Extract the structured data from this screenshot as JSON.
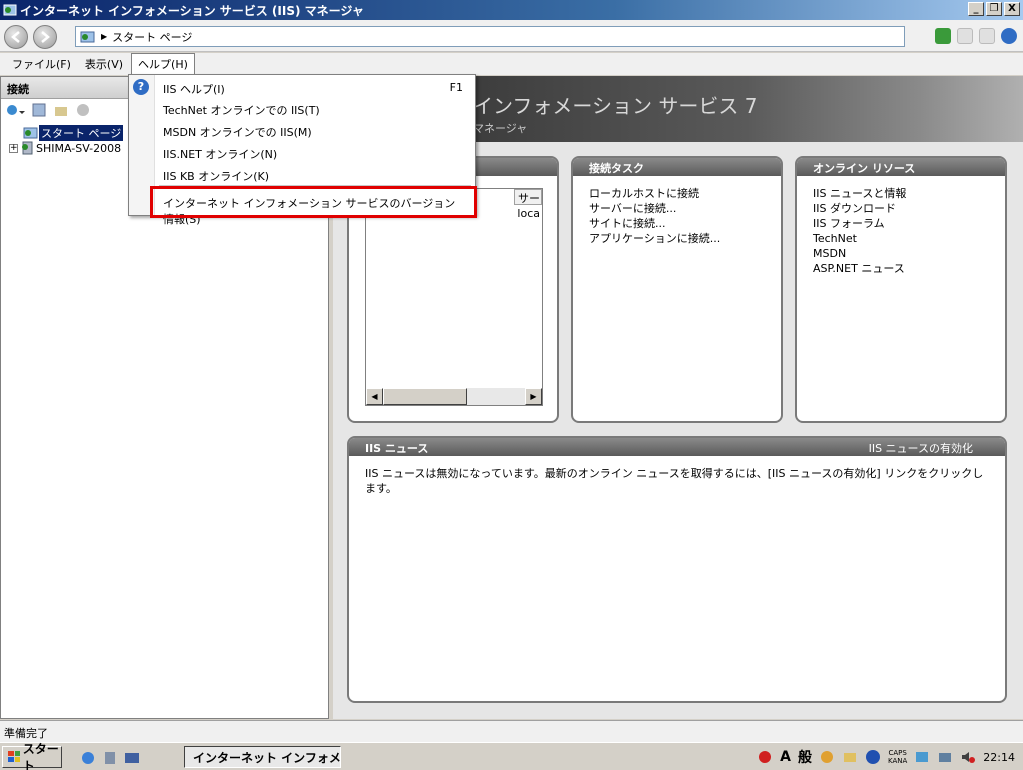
{
  "window": {
    "title": "インターネット インフォメーション サービス (IIS) マネージャ",
    "buttons": [
      "_",
      "❐",
      "X"
    ]
  },
  "address": {
    "path": "スタート ページ"
  },
  "menu": {
    "file": "ファイル(F)",
    "view": "表示(V)",
    "help": "ヘルプ(H)"
  },
  "left_pane": {
    "header": "接続",
    "tree": [
      {
        "label": "スタート ページ",
        "selected": true
      },
      {
        "label": "SHIMA-SV-2008"
      }
    ]
  },
  "banner": {
    "title": "インフォメーション サービス 7",
    "subtitle": "マネージャ"
  },
  "dropdown": {
    "items": [
      {
        "label": "IIS ヘルプ(I)",
        "shortcut": "F1"
      },
      {
        "label": "TechNet オンラインでの IIS(T)"
      },
      {
        "label": "MSDN オンラインでの IIS(M)"
      },
      {
        "label": "IIS.NET オンライン(N)"
      },
      {
        "label": "IIS KB オンライン(K)"
      },
      {
        "label": "インターネット インフォメーション サービスのバージョン情報(S)"
      }
    ]
  },
  "panels": {
    "recent": {
      "col_header": "サー",
      "cell": "loca"
    },
    "connect": {
      "title": "接続タスク",
      "links": [
        "ローカルホストに接続",
        "サーバーに接続...",
        "サイトに接続...",
        "アプリケーションに接続..."
      ]
    },
    "online": {
      "title": "オンライン リソース",
      "links": [
        "IIS ニュースと情報",
        "IIS ダウンロード",
        "IIS フォーラム",
        "TechNet",
        "MSDN",
        "ASP.NET ニュース"
      ]
    },
    "news": {
      "title": "IIS ニュース",
      "enable_link": "IIS ニュースの有効化",
      "message": "IIS ニュースは無効になっています。最新のオンライン ニュースを取得するには、[IIS ニュースの有効化] リンクをクリックします。"
    }
  },
  "status": {
    "text": "準備完了"
  },
  "taskbar": {
    "start": "スタート",
    "task": "インターネット インフォメ...",
    "ime_a": "A",
    "ime_mode": "般",
    "caps": "CAPS",
    "kana": "KANA",
    "clock": "22:14"
  }
}
